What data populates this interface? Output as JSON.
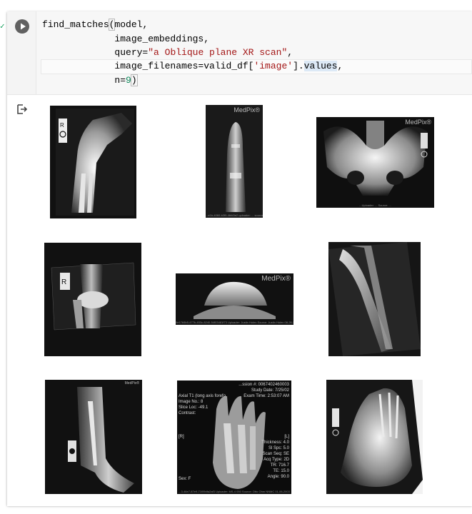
{
  "cell": {
    "code_lines": [
      {
        "parts": [
          {
            "t": "find_matches",
            "c": ""
          },
          {
            "t": "(",
            "c": "paren"
          },
          {
            "t": "model,",
            "c": ""
          }
        ]
      },
      {
        "parts": [
          {
            "t": "             image_embeddings,",
            "c": ""
          }
        ]
      },
      {
        "parts": [
          {
            "t": "             query=",
            "c": ""
          },
          {
            "t": "\"a Oblique plane XR scan\"",
            "c": "str"
          },
          {
            "t": ",",
            "c": ""
          }
        ]
      },
      {
        "parts": [
          {
            "t": "             image_filenames=valid_df[",
            "c": ""
          },
          {
            "t": "'image'",
            "c": "str"
          },
          {
            "t": "].",
            "c": ""
          },
          {
            "t": "values",
            "c": "hl"
          },
          {
            "t": ",",
            "c": ""
          }
        ]
      },
      {
        "parts": [
          {
            "t": "             n=",
            "c": ""
          },
          {
            "t": "9",
            "c": "num"
          },
          {
            "t": ")",
            "c": "paren"
          }
        ]
      }
    ],
    "run_button_icon": "play-icon",
    "output_icon": "output-redirect-icon"
  },
  "results": {
    "images": [
      {
        "name": "result-image-1",
        "label": "Oblique wrist and forearm radiograph",
        "watermark": "",
        "caption": ""
      },
      {
        "name": "result-image-2",
        "label": "Oblique finger radiograph",
        "watermark": "MedPix®",
        "caption": "...e1b-4060-b3f9-4bfd3e2 uploader: ... source: Otto ... 01-06-2003"
      },
      {
        "name": "result-image-3",
        "label": "Pelvis radiograph",
        "watermark": "MedPix®",
        "caption": "...Uploader: ... Source: ..."
      },
      {
        "name": "result-image-4",
        "label": "Oblique knee radiograph",
        "watermark": "",
        "caption": ""
      },
      {
        "name": "result-image-5",
        "label": "Oblique patella radiograph",
        "watermark": "MedPix®",
        "caption": "0e17b5b5-477b-453c-8240-54f03481f73 Uploader: Justin Holen Source: Justin Holen 08-26-2013"
      },
      {
        "name": "result-image-6",
        "label": "Oblique forearm radiograph",
        "watermark": "",
        "caption": ""
      },
      {
        "name": "result-image-7",
        "label": "Oblique lower leg radiograph",
        "watermark": "MedPix®",
        "caption": ""
      },
      {
        "name": "result-image-8",
        "label": "Axial T1 foot MRI",
        "watermark": "",
        "caption": "...3-46e7-87e9-71f09dfa2af3 Uploader: MS-4 050 Source: Otto Ohm NNMC 01-06-2003"
      },
      {
        "name": "result-image-9",
        "label": "Oblique foot radiograph",
        "watermark": "",
        "caption": ""
      }
    ],
    "mri_overlay": {
      "top_right": "...ssion #: 0067402460003\nStudy Date: 7/25/02\nExam Time: 2:53:07 AM",
      "left": "Axial T1 (long axis forefo\nImage No.: 8\nSlice Loc: -49.1\nContrast:",
      "right_marker": "[L]",
      "left_marker": "[R]",
      "bottom_right": "Thickness: 4.0\nSl Spc: 5.0\nScan Seq: SE\nAcq Type: 2D\nTR: 716.7\nTE: 15.0\nAngle: 90.0",
      "bottom_left": "Sex: F"
    }
  }
}
